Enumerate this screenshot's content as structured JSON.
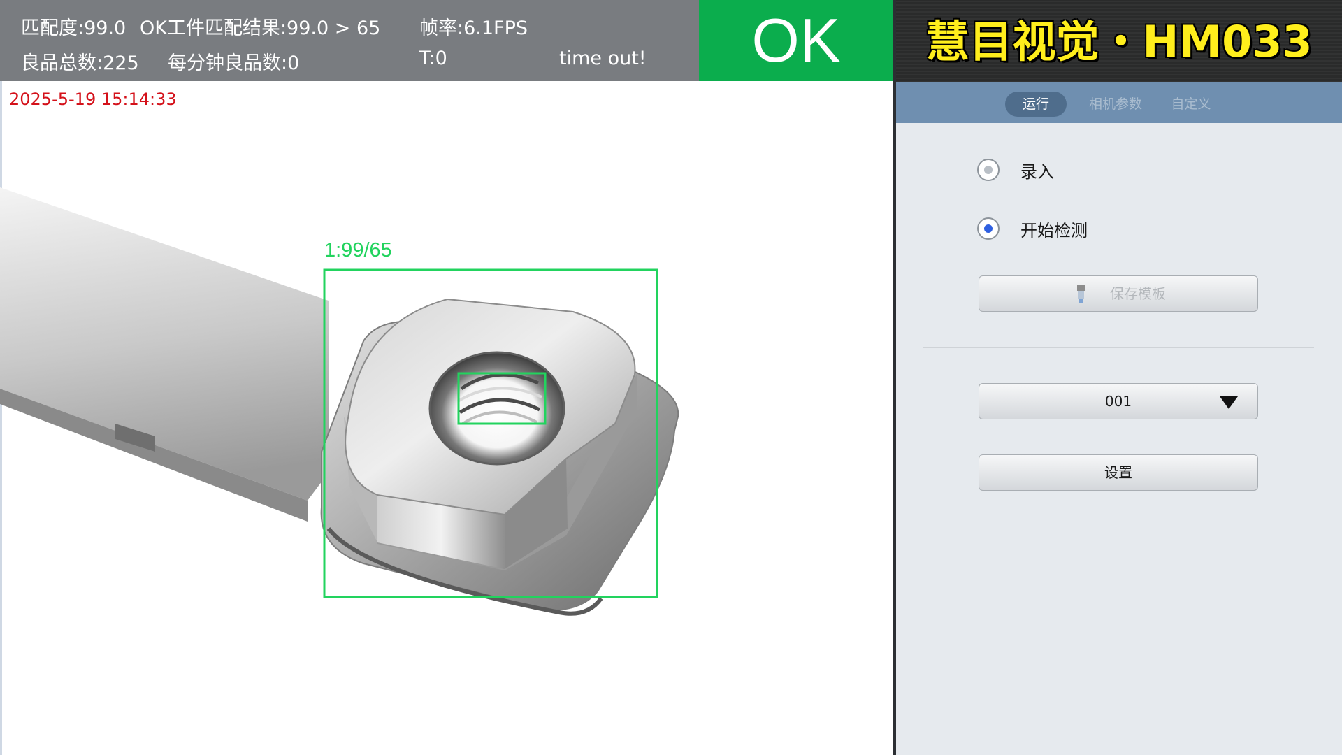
{
  "status": {
    "match_score": "匹配度:99.0",
    "ok_result": "OK工件匹配结果:99.0 > 65",
    "fps": "帧率:6.1FPS",
    "good_total": "良品总数:225",
    "good_per_min": "每分钟良品数:0",
    "t_value": "T:0",
    "timeout": "time out!",
    "result": "OK"
  },
  "viewport": {
    "timestamp": "2025-5-19 15:14:33",
    "match_label": "1:99/65"
  },
  "brand": {
    "title": "慧目视觉・HM033"
  },
  "tabs": [
    {
      "label": "运行",
      "active": true
    },
    {
      "label": "相机参数",
      "active": false
    },
    {
      "label": "自定义",
      "active": false
    }
  ],
  "controls": {
    "radio_record": {
      "label": "录入",
      "selected": false
    },
    "radio_start": {
      "label": "开始检测",
      "selected": true
    },
    "save_template_label": "保存模板",
    "template_select_value": "001",
    "settings_label": "设置"
  },
  "colors": {
    "ok_green": "#0bad4d",
    "match_box": "#22d35e",
    "timestamp_red": "#d4111a",
    "brand_yellow": "#ffee1c",
    "tab_bar": "#6f8fb0",
    "radio_selected": "#2e5fe0"
  }
}
